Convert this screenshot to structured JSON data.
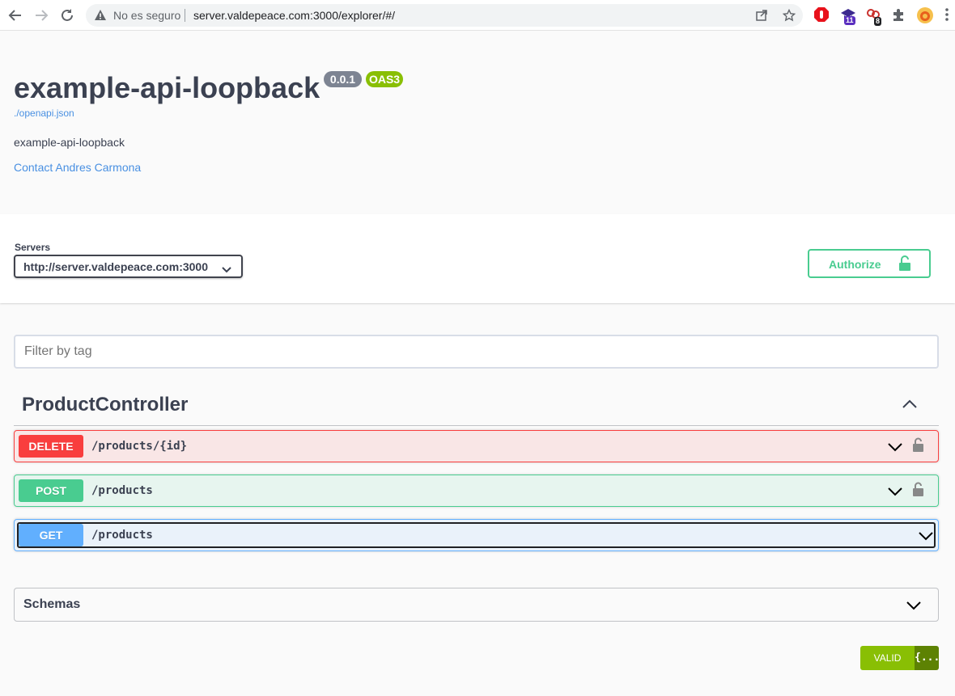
{
  "browser": {
    "security_label": "No es seguro",
    "url": "server.valdepeace.com:3000/explorer/#/",
    "extension_badges": [
      "11",
      "8"
    ]
  },
  "info": {
    "title": "example-api-loopback",
    "version": "0.0.1",
    "oas": "OAS3",
    "spec_link": "./openapi.json",
    "description": "example-api-loopback",
    "contact": "Contact Andres Carmona"
  },
  "servers": {
    "label": "Servers",
    "selected": "http://server.valdepeace.com:3000"
  },
  "authorize_label": "Authorize",
  "filter": {
    "placeholder": "Filter by tag",
    "value": ""
  },
  "tag": {
    "name": "ProductController",
    "operations": [
      {
        "method": "DELETE",
        "path": "/products/{id}"
      },
      {
        "method": "POST",
        "path": "/products"
      },
      {
        "method": "GET",
        "path": "/products"
      }
    ]
  },
  "schemas_label": "Schemas",
  "validator_label": "VALID",
  "validator_icon": "{...}",
  "colors": {
    "delete": "#f93e3e",
    "post": "#49cc90",
    "get": "#61affe",
    "version_badge": "#7d8492",
    "oas_badge": "#89bf04",
    "link": "#4990e2"
  }
}
